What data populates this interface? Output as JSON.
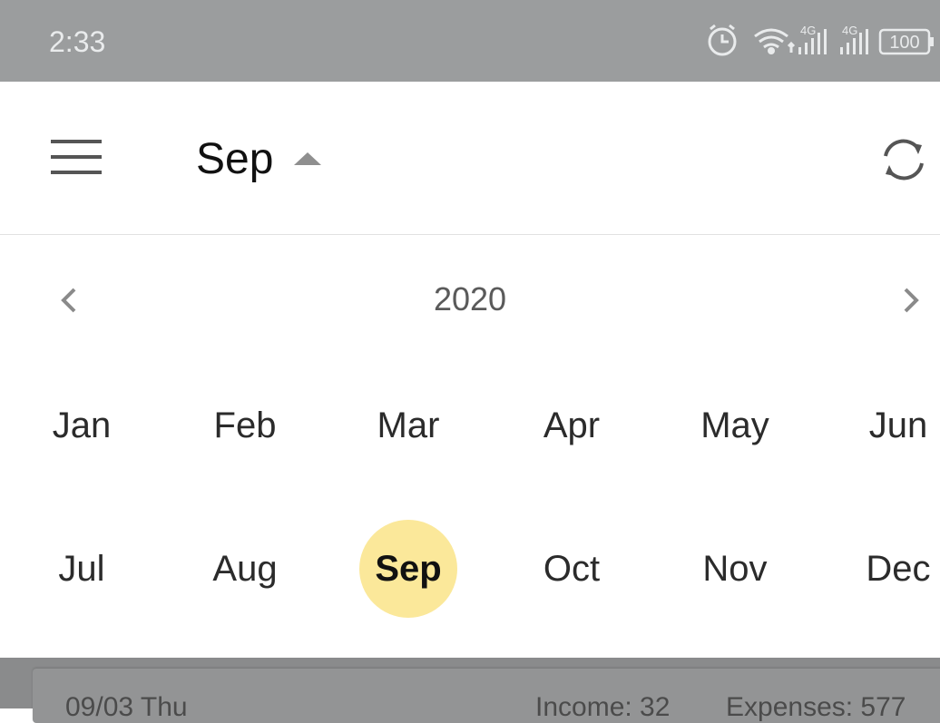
{
  "status_bar": {
    "time": "2:33",
    "battery": "100",
    "network_1": "4G",
    "network_2": "4G",
    "icons": [
      "alarm-icon",
      "wifi-icon",
      "signal-icon",
      "signal-icon",
      "battery-icon"
    ]
  },
  "app_bar": {
    "month_title": "Sep",
    "icons": [
      "menu-icon",
      "caret-up-icon",
      "sync-icon"
    ]
  },
  "picker": {
    "year": "2020",
    "months": [
      "Jan",
      "Feb",
      "Mar",
      "Apr",
      "May",
      "Jun",
      "Jul",
      "Aug",
      "Sep",
      "Oct",
      "Nov",
      "Dec"
    ],
    "selected_month": "Sep",
    "selected_color": "#fbe89a"
  },
  "list_preview": {
    "date": "09/03 Thu",
    "income": "Income: 32",
    "expenses": "Expenses: 577"
  }
}
